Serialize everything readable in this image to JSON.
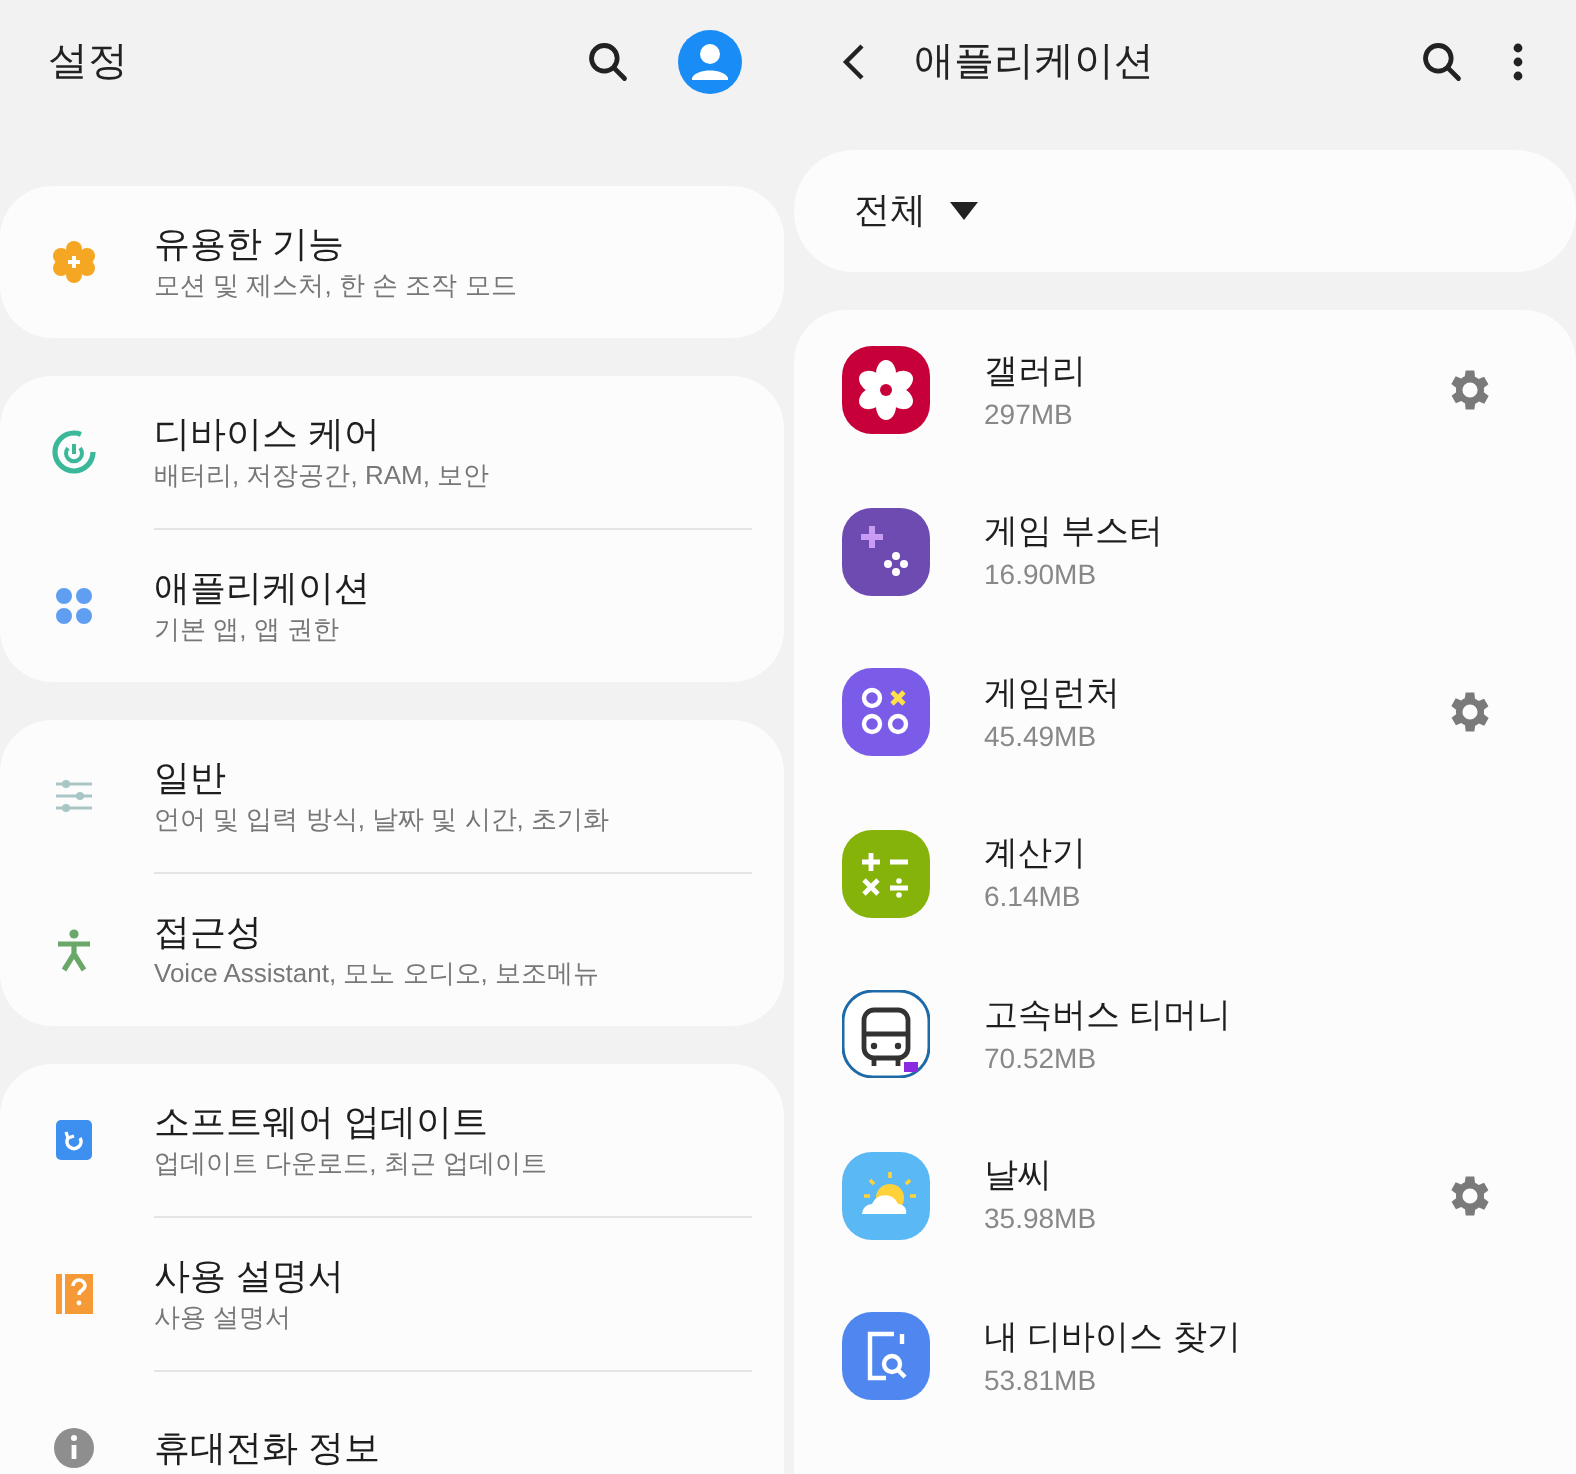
{
  "settings": {
    "title": "설정",
    "groups": [
      {
        "items": [
          {
            "kind": "features",
            "title": "유용한 기능",
            "subtitle": "모션 및 제스처, 한 손 조작 모드"
          }
        ]
      },
      {
        "items": [
          {
            "kind": "care",
            "title": "디바이스 케어",
            "subtitle": "배터리, 저장공간, RAM, 보안"
          },
          {
            "kind": "apps",
            "title": "애플리케이션",
            "subtitle": "기본 앱, 앱 권한"
          }
        ]
      },
      {
        "items": [
          {
            "kind": "general",
            "title": "일반",
            "subtitle": "언어 및 입력 방식, 날짜 및 시간, 초기화"
          },
          {
            "kind": "accessibility",
            "title": "접근성",
            "subtitle": "Voice Assistant, 모노 오디오, 보조메뉴"
          }
        ]
      },
      {
        "items": [
          {
            "kind": "update",
            "title": "소프트웨어 업데이트",
            "subtitle": "업데이트 다운로드, 최근 업데이트"
          },
          {
            "kind": "manual",
            "title": "사용 설명서",
            "subtitle": "사용 설명서"
          },
          {
            "kind": "info",
            "title": "휴대전화 정보"
          }
        ]
      }
    ]
  },
  "applications": {
    "title": "애플리케이션",
    "filter": "전체",
    "apps": [
      {
        "kind": "gallery",
        "name": "갤러리",
        "size": "297MB",
        "settings": true
      },
      {
        "kind": "booster",
        "name": "게임 부스터",
        "size": "16.90MB",
        "settings": false
      },
      {
        "kind": "launcher",
        "name": "게임런처",
        "size": "45.49MB",
        "settings": true
      },
      {
        "kind": "calculator",
        "name": "계산기",
        "size": "6.14MB",
        "settings": false
      },
      {
        "kind": "bus",
        "name": "고속버스 티머니",
        "size": "70.52MB",
        "settings": false
      },
      {
        "kind": "weather",
        "name": "날씨",
        "size": "35.98MB",
        "settings": true
      },
      {
        "kind": "finder",
        "name": "내 디바이스 찾기",
        "size": "53.81MB",
        "settings": false
      }
    ]
  }
}
